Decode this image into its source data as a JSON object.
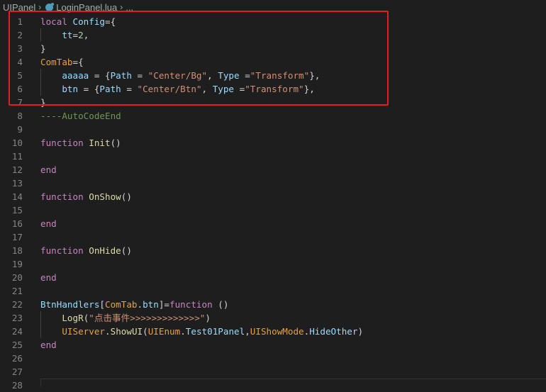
{
  "breadcrumb": {
    "folder": "UIPanel",
    "file": "LoginPanel.lua",
    "more": "..."
  },
  "editor": {
    "lines": [
      {
        "n": "1",
        "tokens": [
          {
            "t": "local ",
            "c": "kw"
          },
          {
            "t": "Config",
            "c": "var"
          },
          {
            "t": "={",
            "c": "pl"
          }
        ]
      },
      {
        "n": "2",
        "tokens": [
          {
            "t": "    tt",
            "c": "var"
          },
          {
            "t": "=",
            "c": "pl"
          },
          {
            "t": "2",
            "c": "num"
          },
          {
            "t": ",",
            "c": "pl"
          }
        ]
      },
      {
        "n": "3",
        "tokens": [
          {
            "t": "}",
            "c": "pl"
          }
        ]
      },
      {
        "n": "4",
        "tokens": [
          {
            "t": "ComTab",
            "c": "obj"
          },
          {
            "t": "={",
            "c": "pl"
          }
        ]
      },
      {
        "n": "5",
        "tokens": [
          {
            "t": "    aaaaa",
            "c": "var"
          },
          {
            "t": " = {",
            "c": "pl"
          },
          {
            "t": "Path",
            "c": "var"
          },
          {
            "t": " = ",
            "c": "pl"
          },
          {
            "t": "\"Center/Bg\"",
            "c": "str"
          },
          {
            "t": ", ",
            "c": "pl"
          },
          {
            "t": "Type",
            "c": "var"
          },
          {
            "t": " =",
            "c": "pl"
          },
          {
            "t": "\"Transform\"",
            "c": "str"
          },
          {
            "t": "},",
            "c": "pl"
          }
        ]
      },
      {
        "n": "6",
        "tokens": [
          {
            "t": "    btn",
            "c": "var"
          },
          {
            "t": " = {",
            "c": "pl"
          },
          {
            "t": "Path",
            "c": "var"
          },
          {
            "t": " = ",
            "c": "pl"
          },
          {
            "t": "\"Center/Btn\"",
            "c": "str"
          },
          {
            "t": ", ",
            "c": "pl"
          },
          {
            "t": "Type",
            "c": "var"
          },
          {
            "t": " =",
            "c": "pl"
          },
          {
            "t": "\"Transform\"",
            "c": "str"
          },
          {
            "t": "},",
            "c": "pl"
          }
        ]
      },
      {
        "n": "7",
        "tokens": [
          {
            "t": "}",
            "c": "pl"
          }
        ]
      },
      {
        "n": "8",
        "tokens": [
          {
            "t": "----AutoCodeEnd",
            "c": "cmt"
          }
        ]
      },
      {
        "n": "9",
        "tokens": []
      },
      {
        "n": "10",
        "tokens": [
          {
            "t": "function ",
            "c": "kw"
          },
          {
            "t": "Init",
            "c": "fn"
          },
          {
            "t": "()",
            "c": "pl"
          }
        ]
      },
      {
        "n": "11",
        "tokens": []
      },
      {
        "n": "12",
        "tokens": [
          {
            "t": "end",
            "c": "kw"
          }
        ]
      },
      {
        "n": "13",
        "tokens": []
      },
      {
        "n": "14",
        "tokens": [
          {
            "t": "function ",
            "c": "kw"
          },
          {
            "t": "OnShow",
            "c": "fn"
          },
          {
            "t": "()",
            "c": "pl"
          }
        ]
      },
      {
        "n": "15",
        "tokens": []
      },
      {
        "n": "16",
        "tokens": [
          {
            "t": "end",
            "c": "kw"
          }
        ]
      },
      {
        "n": "17",
        "tokens": []
      },
      {
        "n": "18",
        "tokens": [
          {
            "t": "function ",
            "c": "kw"
          },
          {
            "t": "OnHide",
            "c": "fn"
          },
          {
            "t": "()",
            "c": "pl"
          }
        ]
      },
      {
        "n": "19",
        "tokens": []
      },
      {
        "n": "20",
        "tokens": [
          {
            "t": "end",
            "c": "kw"
          }
        ]
      },
      {
        "n": "21",
        "tokens": []
      },
      {
        "n": "22",
        "tokens": [
          {
            "t": "BtnHandlers",
            "c": "var"
          },
          {
            "t": "[",
            "c": "pl"
          },
          {
            "t": "ComTab",
            "c": "obj"
          },
          {
            "t": ".",
            "c": "pl"
          },
          {
            "t": "btn",
            "c": "var"
          },
          {
            "t": "]=",
            "c": "pl"
          },
          {
            "t": "function",
            "c": "kw"
          },
          {
            "t": " ()",
            "c": "pl"
          }
        ]
      },
      {
        "n": "23",
        "tokens": [
          {
            "t": "    ",
            "c": "pl"
          },
          {
            "t": "LogR",
            "c": "fn"
          },
          {
            "t": "(",
            "c": "pl"
          },
          {
            "t": "\"点击事件>>>>>>>>>>>>>\"",
            "c": "str"
          },
          {
            "t": ")",
            "c": "pl"
          }
        ]
      },
      {
        "n": "24",
        "tokens": [
          {
            "t": "    ",
            "c": "pl"
          },
          {
            "t": "UIServer",
            "c": "obj"
          },
          {
            "t": ".",
            "c": "pl"
          },
          {
            "t": "ShowUI",
            "c": "fn"
          },
          {
            "t": "(",
            "c": "pl"
          },
          {
            "t": "UIEnum",
            "c": "obj"
          },
          {
            "t": ".",
            "c": "pl"
          },
          {
            "t": "Test01Panel",
            "c": "var"
          },
          {
            "t": ",",
            "c": "pl"
          },
          {
            "t": "UIShowMode",
            "c": "obj"
          },
          {
            "t": ".",
            "c": "pl"
          },
          {
            "t": "HideOther",
            "c": "var"
          },
          {
            "t": ")",
            "c": "pl"
          }
        ]
      },
      {
        "n": "25",
        "tokens": [
          {
            "t": "end",
            "c": "kw"
          }
        ]
      },
      {
        "n": "26",
        "tokens": []
      },
      {
        "n": "27",
        "tokens": []
      },
      {
        "n": "28",
        "tokens": []
      }
    ]
  },
  "colors": {
    "background": "#1e1e1e",
    "highlight_box": "#e51c23",
    "keyword": "#c586c0",
    "string": "#ce9178",
    "comment": "#6a9955"
  }
}
